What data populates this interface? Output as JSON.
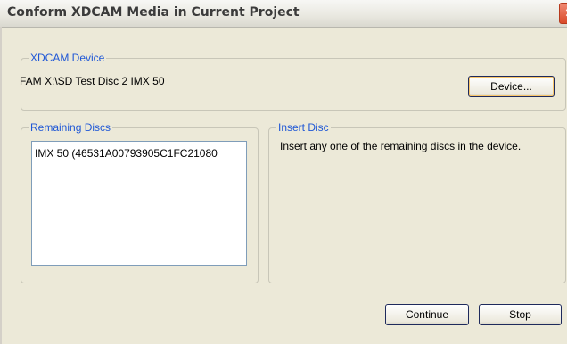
{
  "window": {
    "title": "Conform XDCAM Media in Current Project",
    "close_glyph": "✕"
  },
  "device_group": {
    "legend": "XDCAM Device",
    "device_name": "FAM X:\\SD Test Disc 2 IMX 50",
    "device_button": "Device..."
  },
  "remaining_group": {
    "legend": "Remaining Discs",
    "items": [
      "IMX 50 (46531A00793905C1FC21080"
    ]
  },
  "insert_group": {
    "legend": "Insert Disc",
    "message": "Insert any one of the remaining discs in the device."
  },
  "actions": {
    "continue_label": "Continue",
    "stop_label": "Stop"
  },
  "colors": {
    "legend_text": "#1f57d6",
    "dialog_bg": "#ece9d8"
  }
}
